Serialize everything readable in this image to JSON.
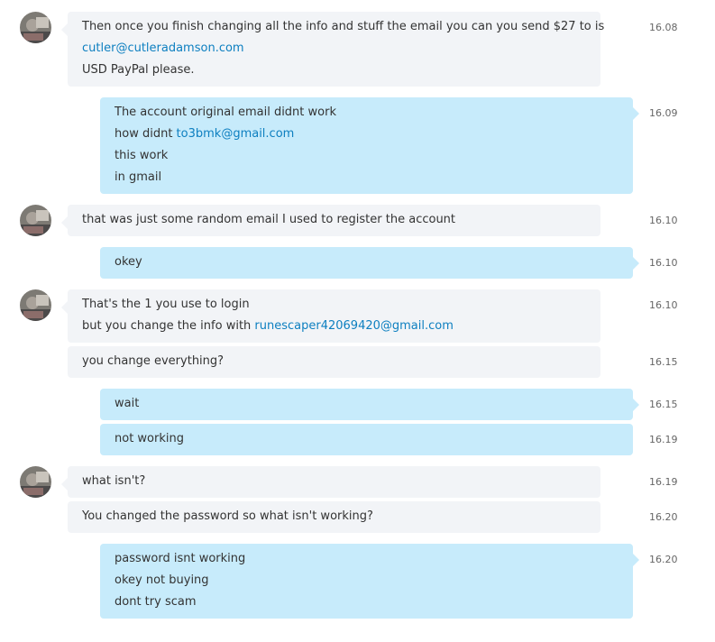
{
  "conversation": {
    "colors": {
      "incoming": "#f2f4f7",
      "outgoing": "#c7ebfb",
      "link": "#0d7fc0"
    },
    "messages": [
      {
        "dir": "in",
        "avatar": true,
        "time": "16.08",
        "lines": [
          [
            {
              "text": "Then once you finish changing all the info and stuff the email you can you send $27 to is"
            }
          ],
          [
            {
              "text": "cutler@cutleradamson.com",
              "link": true
            }
          ],
          [
            {
              "text": "USD PayPal please."
            }
          ]
        ]
      },
      {
        "dir": "out",
        "time": "16.09",
        "lines": [
          [
            {
              "text": "The account original email didnt work"
            }
          ],
          [
            {
              "text": "how didnt "
            },
            {
              "text": "to3bmk@gmail.com",
              "link": true
            }
          ],
          [
            {
              "text": "this work"
            }
          ],
          [
            {
              "text": "in gmail"
            }
          ]
        ]
      },
      {
        "dir": "in",
        "avatar": true,
        "time": "16.10",
        "lines": [
          [
            {
              "text": "that was just some random email I used to register the account"
            }
          ]
        ]
      },
      {
        "dir": "out",
        "time": "16.10",
        "lines": [
          [
            {
              "text": "okey"
            }
          ]
        ]
      },
      {
        "dir": "in",
        "avatar": true,
        "time": "16.10",
        "lines": [
          [
            {
              "text": "That's the 1 you use to login"
            }
          ],
          [
            {
              "text": "but you change the info with "
            },
            {
              "text": "runescaper42069420@gmail.com",
              "link": true
            }
          ]
        ]
      },
      {
        "dir": "in",
        "time": "16.15",
        "lines": [
          [
            {
              "text": "you change everything?"
            }
          ]
        ]
      },
      {
        "dir": "out",
        "time": "16.15",
        "lines": [
          [
            {
              "text": "wait"
            }
          ]
        ]
      },
      {
        "dir": "out",
        "time": "16.19",
        "lines": [
          [
            {
              "text": "not working"
            }
          ]
        ]
      },
      {
        "dir": "in",
        "avatar": true,
        "time": "16.19",
        "lines": [
          [
            {
              "text": "what isn't?"
            }
          ]
        ]
      },
      {
        "dir": "in",
        "time": "16.20",
        "lines": [
          [
            {
              "text": "You changed the password so what isn't working?"
            }
          ]
        ]
      },
      {
        "dir": "out",
        "time": "16.20",
        "lines": [
          [
            {
              "text": "password isnt working"
            }
          ],
          [
            {
              "text": "okey not buying"
            }
          ],
          [
            {
              "text": "dont try scam"
            }
          ]
        ]
      }
    ]
  }
}
